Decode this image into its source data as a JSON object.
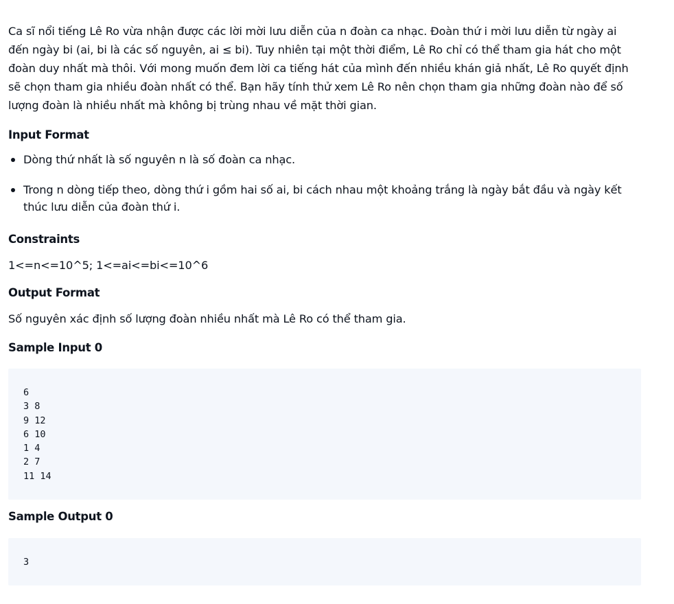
{
  "intro": "Ca sĩ nổi tiếng Lê Ro vừa nhận được các lời mời lưu diễn của n đoàn ca nhạc. Đoàn thứ i mời lưu diễn từ ngày ai đến ngày bi (ai, bi là các số nguyên, ai ≤ bi). Tuy nhiên tại một thời điểm, Lê Ro chỉ có thể tham gia hát cho một đoàn duy nhất mà thôi. Với mong muốn đem lời ca tiếng hát của mình đến nhiều khán giả nhất, Lê Ro quyết định sẽ chọn tham gia nhiều đoàn nhất có thể. Bạn hãy tính thử xem Lê Ro nên chọn tham gia những đoàn nào để số lượng đoàn là nhiều nhất mà không bị trùng nhau về mặt thời gian.",
  "input_format": {
    "heading": "Input Format",
    "items": [
      "Dòng thứ nhất là số nguyên n là số đoàn ca nhạc.",
      "Trong n dòng tiếp theo, dòng thứ i gồm hai số ai, bi cách nhau một khoảng trắng là ngày bắt đầu và ngày kết thúc lưu diễn của đoàn thứ i."
    ]
  },
  "constraints": {
    "heading": "Constraints",
    "text": "1<=n<=10^5; 1<=ai<=bi<=10^6"
  },
  "output_format": {
    "heading": "Output Format",
    "text": "Số nguyên xác định số lượng đoàn nhiều nhất mà Lê Ro có thể tham gia."
  },
  "sample_input": {
    "heading": "Sample Input 0",
    "lines": [
      "6",
      "3 8",
      "9 12",
      "6 10",
      "1 4",
      "2 7",
      "11 14"
    ]
  },
  "sample_output": {
    "heading": "Sample Output 0",
    "lines": [
      "3"
    ]
  }
}
